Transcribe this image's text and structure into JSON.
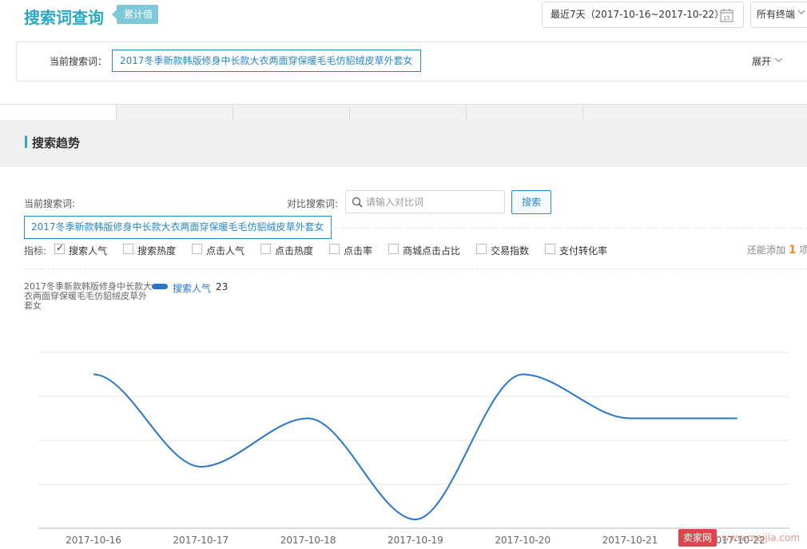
{
  "header": {
    "title": "搜索词查询",
    "badge": "累计值",
    "date_range": "最近7天（2017-10-16~2017-10-22）",
    "calendar_day": "15",
    "device": "所有终端"
  },
  "current_keyword_panel": {
    "label": "当前搜索词：",
    "keyword": "2017冬季新款韩版修身中长款大衣两面穿保暖毛毛仿貂绒皮草外套女",
    "expand": "展开"
  },
  "section": {
    "title": "搜索趋势"
  },
  "query": {
    "current_label": "当前搜索词:",
    "compare_label": "对比搜索词:",
    "compare_placeholder": "请输入对比词",
    "search_button": "搜索",
    "keyword_tag": "2017冬季新款韩版修身中长款大衣两面穿保暖毛毛仿貂绒皮草外套女"
  },
  "metrics": {
    "label": "指标:",
    "items": [
      {
        "label": "搜索人气",
        "checked": true
      },
      {
        "label": "搜索热度",
        "checked": false
      },
      {
        "label": "点击人气",
        "checked": false
      },
      {
        "label": "点击热度",
        "checked": false
      },
      {
        "label": "点击率",
        "checked": false
      },
      {
        "label": "商城点击占比",
        "checked": false
      },
      {
        "label": "交易指数",
        "checked": false
      },
      {
        "label": "支付转化率",
        "checked": false
      }
    ],
    "remain_prefix": "还能添加",
    "remain_count": "1",
    "remain_suffix": "项"
  },
  "legend": {
    "keyword": "2017冬季新款韩版修身中长款大衣两面穿保暖毛毛仿貂绒皮草外套女",
    "series_name": "搜索人气",
    "value": "23",
    "color": "#2a76c6"
  },
  "chart_data": {
    "type": "line",
    "categories": [
      "2017-10-16",
      "2017-10-17",
      "2017-10-18",
      "2017-10-19",
      "2017-10-20",
      "2017-10-21",
      "2017-10-22"
    ],
    "series": [
      {
        "name": "搜索人气",
        "values": [
          35,
          14,
          25,
          2,
          35,
          25,
          25
        ]
      }
    ],
    "ylim": [
      0,
      40
    ],
    "grid": true,
    "color": "#2a76c6"
  },
  "watermark": {
    "logo": "卖家网",
    "url": "www.maijia.com"
  }
}
